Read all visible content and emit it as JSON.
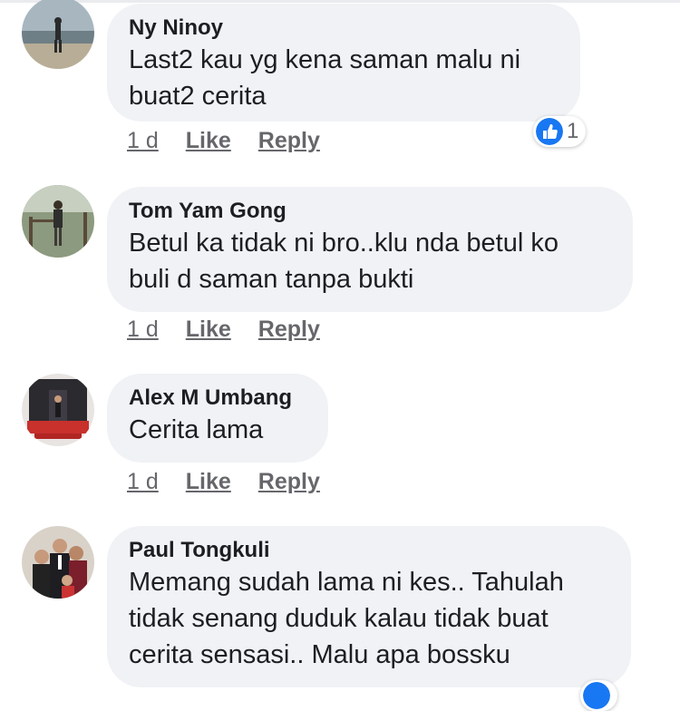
{
  "comments": [
    {
      "author": "Ny Ninoy",
      "text": "Last2 kau yg kena saman malu ni\nbuat2 cerita",
      "time": "1 d",
      "like": "Like",
      "reply": "Reply",
      "reaction_count": "1",
      "reaction_icon": "thumbs-up-icon"
    },
    {
      "author": "Tom Yam Gong",
      "text": "Betul ka tidak ni bro..klu nda betul ko\nbuli d saman tanpa bukti",
      "time": "1 d",
      "like": "Like",
      "reply": "Reply"
    },
    {
      "author": "Alex M Umbang",
      "text": "Cerita lama",
      "time": "1 d",
      "like": "Like",
      "reply": "Reply"
    },
    {
      "author": "Paul Tongkuli",
      "text": "Memang sudah lama ni kes.. Tahulah\ntidak senang duduk kalau tidak buat\ncerita sensasi.. Malu apa bossku",
      "reaction_icon": "thumbs-up-icon"
    }
  ],
  "colors": {
    "bubble": "#f0f2f5",
    "text": "#1c1e21",
    "meta": "#65676b",
    "like_blue": "#1877f2"
  }
}
